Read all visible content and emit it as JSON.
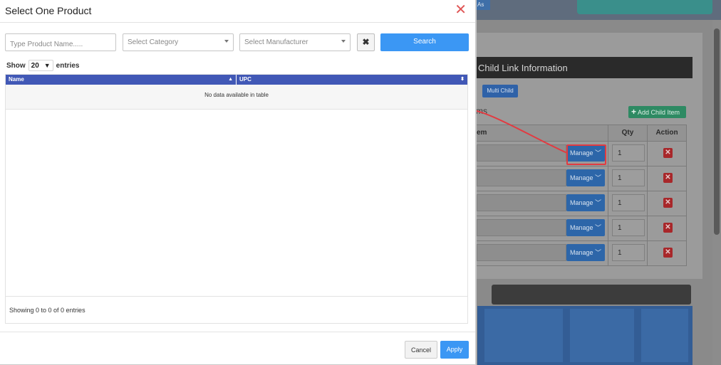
{
  "background": {
    "tab_label": "As",
    "card_title": "Child Link Information",
    "multi_child_label": "Multi Child",
    "items_label": "ms",
    "add_child_label": "Add Child Item",
    "table_headers": [
      "em",
      "Qty",
      "Action"
    ],
    "rows": [
      {
        "manage": "Manage",
        "qty": "1"
      },
      {
        "manage": "Manage",
        "qty": "1"
      },
      {
        "manage": "Manage",
        "qty": "1"
      },
      {
        "manage": "Manage",
        "qty": "1"
      },
      {
        "manage": "Manage",
        "qty": "1"
      }
    ]
  },
  "modal": {
    "title": "Select One Product",
    "close_glyph": "✕",
    "filters": {
      "product_placeholder": "Type Product Name.....",
      "category_placeholder": "Select Category",
      "manufacturer_placeholder": "Select Manufacturer",
      "clear_glyph": "✖",
      "search_label": "Search"
    },
    "show": {
      "prefix": "Show",
      "value": "20",
      "suffix": "entries"
    },
    "table": {
      "columns": [
        "Name",
        "UPC"
      ],
      "empty_message": "No data available in table",
      "info": "Showing 0 to 0 of 0 entries"
    },
    "footer": {
      "cancel_label": "Cancel",
      "apply_label": "Apply"
    }
  },
  "colors": {
    "accent": "#3b97f4",
    "table_header": "#4158b6",
    "close": "#e05656",
    "highlight": "#e23b41"
  }
}
